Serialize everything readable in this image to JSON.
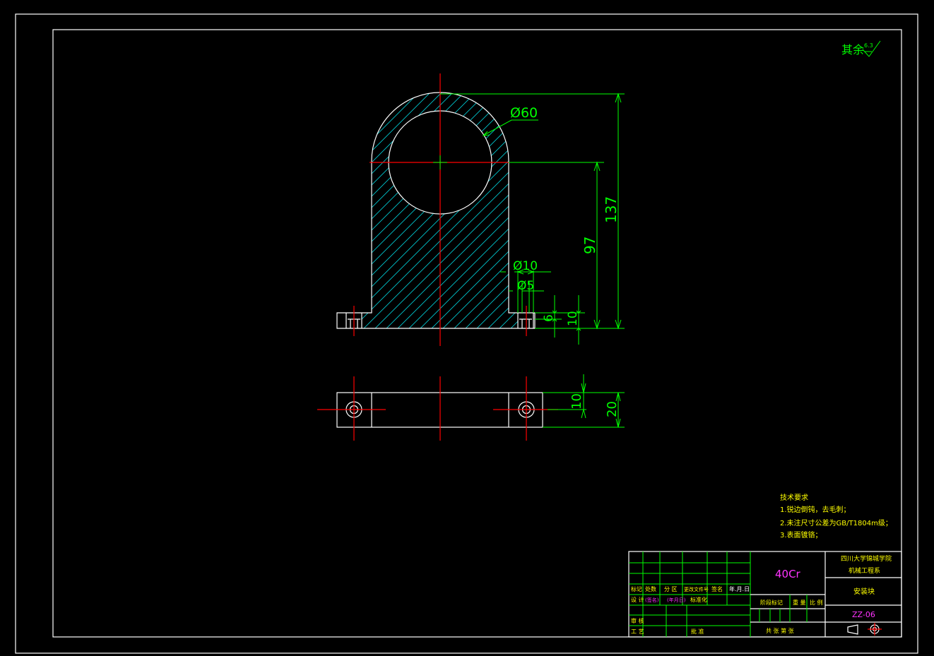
{
  "roughness": {
    "prefix": "其余",
    "value": "6.3"
  },
  "dimensions": {
    "outer_diameter": "Ø60",
    "height_total": "137",
    "height_center": "97",
    "counterbore_dia": "Ø10",
    "hole_dia": "Ø5",
    "counterbore_depth": "6",
    "base_thickness": "10",
    "top_view_half": "10",
    "top_view_width": "20"
  },
  "tech_requirements": {
    "title": "技术要求",
    "items": [
      "1.锐边倒钝，去毛刺；",
      "2.未注尺寸公差为GB/T1804m级；",
      "3.表面镀铬；"
    ]
  },
  "title_block": {
    "material": "40Cr",
    "school_line1": "四川大学锦城学院",
    "school_line2": "机械工程系",
    "part_name": "安装块",
    "drawing_no": "ZZ-06",
    "headers": [
      "标记",
      "处数",
      "分 区",
      "更改文件号",
      "签名",
      "年.月.日"
    ],
    "design_label": "设 计",
    "sign_placeholder": "(签名)",
    "date_placeholder": "(年月日)",
    "standardize": "标准化",
    "stage_mark": "阶段标记",
    "weight": "重 量",
    "scale": "比 例",
    "review": "审 核",
    "process": "工 艺",
    "approve": "批 准",
    "sheets": "共   张   第   张"
  }
}
